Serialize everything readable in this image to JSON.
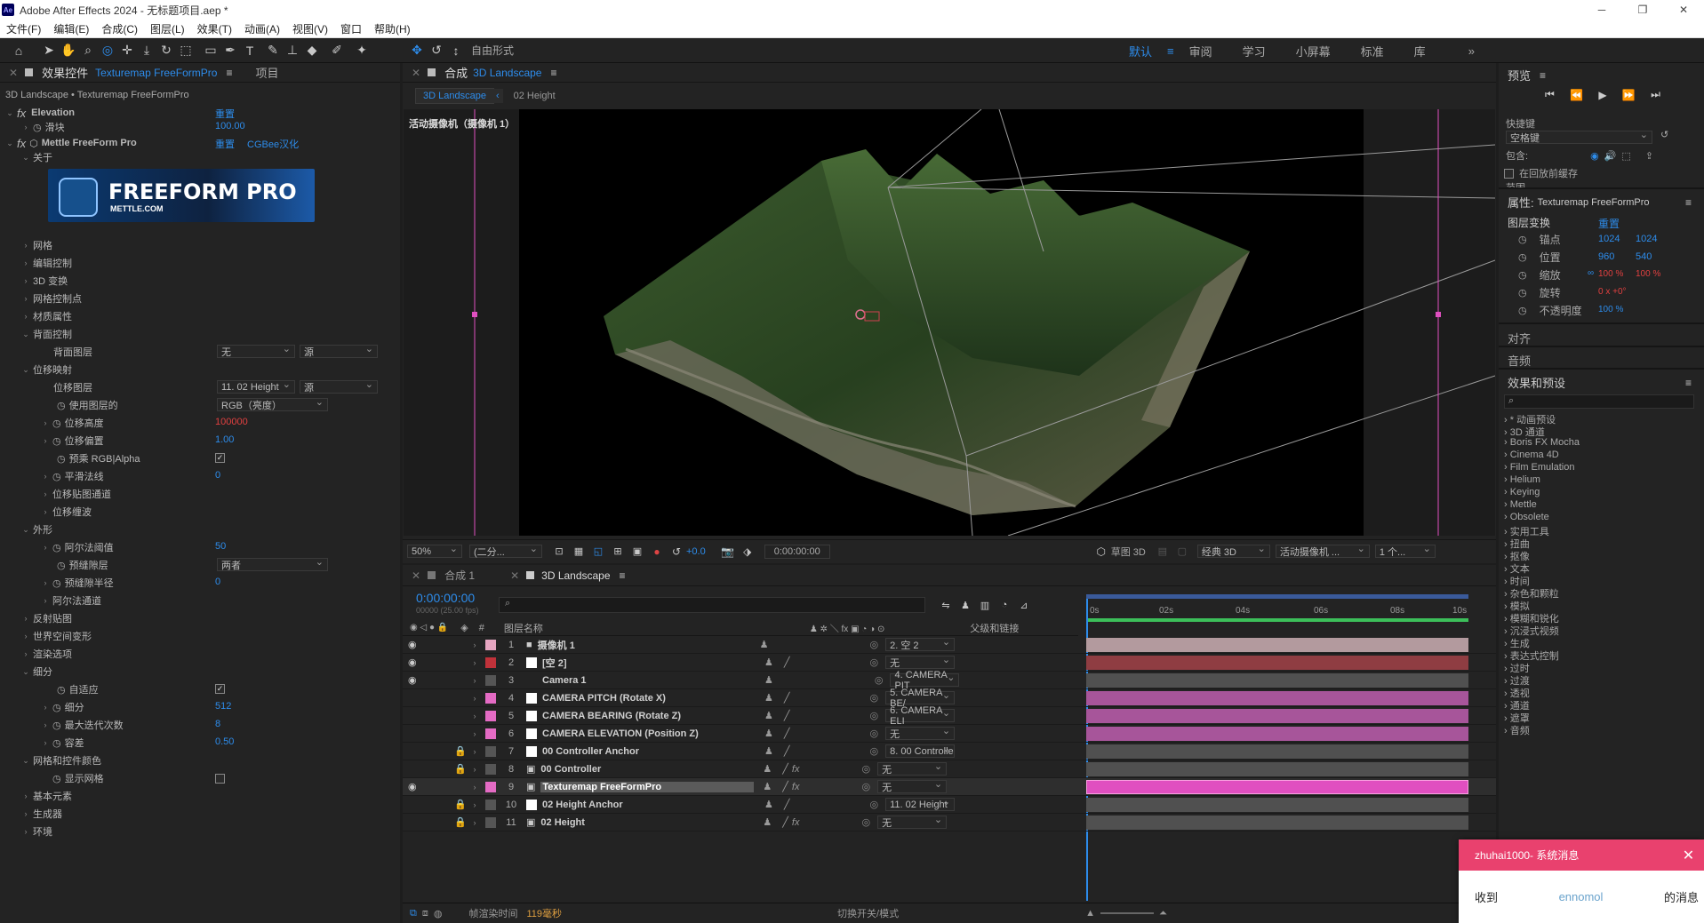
{
  "window": {
    "title": "Adobe After Effects 2024 - 无标题项目.aep *",
    "app_icon": "Ae",
    "minimize": "─",
    "maximize": "❐",
    "close": "✕"
  },
  "menu": [
    "文件(F)",
    "编辑(E)",
    "合成(C)",
    "图层(L)",
    "效果(T)",
    "动画(A)",
    "视图(V)",
    "窗口",
    "帮助(H)"
  ],
  "toolbar": {
    "free_form_label": "自由形式",
    "workspaces": [
      "默认",
      "审阅",
      "学习",
      "小屏幕",
      "标准",
      "库"
    ],
    "more": "»"
  },
  "effect_controls": {
    "tab_label": "效果控件",
    "tab_layer": "Texturemap FreeFormPro",
    "tab_menu": "≡",
    "project_tab": "项目",
    "breadcrumb": "3D Landscape • Texturemap FreeFormPro",
    "elevation": {
      "name": "Elevation",
      "reset": "重置",
      "slider_label": "滑块",
      "slider_value": "100.00"
    },
    "mettle": {
      "name": "Mettle FreeForm Pro",
      "reset": "重置",
      "extra": "CGBee汉化",
      "about": "关于",
      "logo_title": "FREEFORM PRO",
      "logo_sub": "METTLE.COM"
    },
    "rows": {
      "mesh": "网格",
      "edit_ctrl": "编辑控制",
      "t3d": "3D 变换",
      "mesh_pts": "网格控制点",
      "material": "材质属性",
      "back_ctrl": "背面控制",
      "back_layer": "背面图层",
      "back_layer_val": "无",
      "back_layer_src": "源",
      "disp_map": "位移映射",
      "disp_layer": "位移图层",
      "disp_layer_val": "11. 02 Height",
      "disp_layer_src": "源",
      "use_layer": "使用图层的",
      "use_layer_val": "RGB（亮度）",
      "disp_height": "位移高度",
      "disp_height_val": "100000",
      "disp_offset": "位移偏置",
      "disp_offset_val": "1.00",
      "premult": "预乘 RGB|Alpha",
      "smooth": "平滑法线",
      "smooth_val": "0",
      "disp_channel": "位移贴图通道",
      "disp_wave": "位移缠波",
      "shape": "外形",
      "alpha_th": "阿尔法阈值",
      "alpha_th_val": "50",
      "bevel_type": "预缝隙层",
      "bevel_type_val": "两者",
      "bevel_radius": "预缝隙半径",
      "bevel_radius_val": "0",
      "alpha_channel": "阿尔法通道",
      "reflect": "反射贴图",
      "world_xform": "世界空间变形",
      "render_opts": "渲染选项",
      "subdiv": "细分",
      "adaptive": "自适应",
      "subdiv_amt": "细分",
      "subdiv_amt_val": "512",
      "max_iter": "最大迭代次数",
      "max_iter_val": "8",
      "tolerance": "容差",
      "tolerance_val": "0.50",
      "mesh_color": "网格和控件颜色",
      "show_mesh": "显示网格",
      "basic": "基本元素",
      "generator": "生成器",
      "env": "环境"
    }
  },
  "composition": {
    "panel_label": "合成",
    "comp_name": "3D Landscape",
    "menu": "≡",
    "flow_tab": "3D Landscape",
    "flow_next": "02 Height",
    "camera_label": "活动摄像机（摄像机 1）",
    "zoom": "50%",
    "resolution": "(二分...",
    "exposure": "+0.0",
    "timecode": "0:00:00:00",
    "draft": "草图 3D",
    "renderer": "经典 3D",
    "camera_select": "活动摄像机 ...",
    "views": "1 个..."
  },
  "timeline": {
    "tabs": [
      "合成 1",
      "3D Landscape"
    ],
    "timecode": "0:00:00:00",
    "fps": "00000 (25.00 fps)",
    "col_num": "#",
    "col_name": "图层名称",
    "col_parent": "父级和链接",
    "ruler": [
      "0s",
      "02s",
      "04s",
      "06s",
      "08s",
      "10s"
    ],
    "layers": [
      {
        "num": "1",
        "name": "摄像机 1",
        "parent": "2. 空 2",
        "label": "#e6a6c1",
        "bar": "#b39a9e"
      },
      {
        "num": "2",
        "name": "[空 2]",
        "parent": "无",
        "label": "#c0323a",
        "bar": "#8f3d42"
      },
      {
        "num": "3",
        "name": "Camera 1",
        "parent": "4. CAMERA PIT",
        "label": "#555555",
        "bar": "#505050"
      },
      {
        "num": "4",
        "name": "CAMERA PITCH (Rotate X)",
        "parent": "5. CAMERA BE/",
        "label": "#e46bc4",
        "bar": "#a7559a"
      },
      {
        "num": "5",
        "name": "CAMERA BEARING (Rotate Z)",
        "parent": "6. CAMERA ELI",
        "label": "#e46bc4",
        "bar": "#a7559a"
      },
      {
        "num": "6",
        "name": "CAMERA ELEVATION (Position Z)",
        "parent": "无",
        "label": "#e46bc4",
        "bar": "#a7559a"
      },
      {
        "num": "7",
        "name": "00 Controller Anchor",
        "parent": "8. 00 Controlle",
        "label": "#555555",
        "bar": "#505050"
      },
      {
        "num": "8",
        "name": "00 Controller",
        "parent": "无",
        "label": "#555555",
        "bar": "#505050"
      },
      {
        "num": "9",
        "name": "Texturemap FreeFormPro",
        "parent": "无",
        "label": "#e46bc4",
        "bar": "#e04fc0"
      },
      {
        "num": "10",
        "name": "02 Height Anchor",
        "parent": "11. 02 Height",
        "label": "#555555",
        "bar": "#505050"
      },
      {
        "num": "11",
        "name": "02 Height",
        "parent": "无",
        "label": "#555555",
        "bar": "#505050"
      }
    ],
    "status_label": "帧渲染时间",
    "render_time": "119毫秒",
    "switch_label": "切换开关/模式"
  },
  "right": {
    "preview": "预览",
    "shortcut": "快捷键",
    "shortcut_val": "空格键",
    "include": "包含:",
    "cache": "在回放前缓存",
    "range": "范围",
    "props": "属性:",
    "props_layer": "Texturemap FreeFormPro",
    "layer_transform": "图层变换",
    "reset": "重置",
    "anchor": "锚点",
    "anchor_x": "1024",
    "anchor_y": "1024",
    "position": "位置",
    "pos_x": "960",
    "pos_y": "540",
    "scale": "缩放",
    "scale_x": "100 %",
    "scale_y": "100 %",
    "rotation": "旋转",
    "rotation_val": "0 x +0°",
    "opacity": "不透明度",
    "opacity_val": "100 %",
    "align": "对齐",
    "audio": "音频",
    "fx_presets": "效果和预设",
    "fx_list": [
      "* 动画预设",
      "3D 通道",
      "Boris FX Mocha",
      "Cinema 4D",
      "Film Emulation",
      "Helium",
      "Keying",
      "Mettle",
      "Obsolete",
      "实用工具",
      "扭曲",
      "抠像",
      "文本",
      "时间",
      "杂色和颗粒",
      "模拟",
      "模糊和锐化",
      "沉浸式视频",
      "生成",
      "表达式控制",
      "过时",
      "过渡",
      "透视",
      "通道",
      "遮罩",
      "音频"
    ]
  },
  "popup": {
    "title": "zhuhai1000- 系统消息",
    "received": "收到",
    "user": "ennomol",
    "suffix": "的消息",
    "close": "✕"
  },
  "colors": {
    "accent": "#2d8ceb",
    "popup": "#e9416e"
  }
}
